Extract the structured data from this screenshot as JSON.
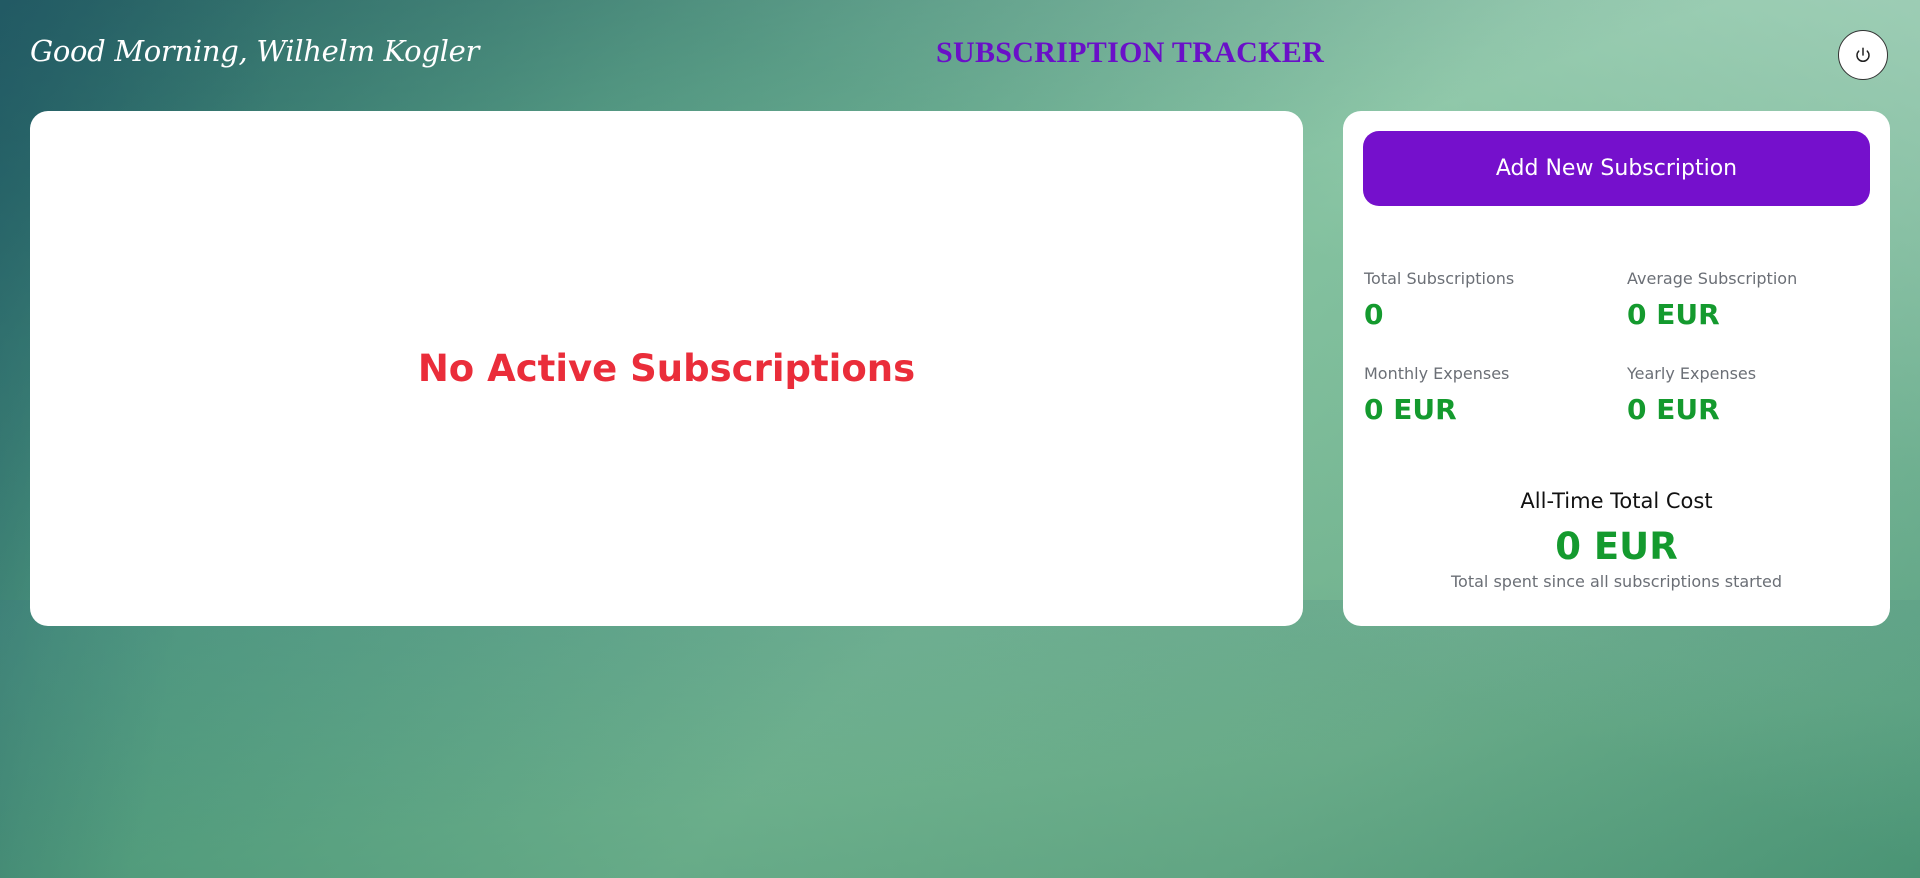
{
  "header": {
    "greeting": "Good Morning, Wilhelm Kogler",
    "app_title": "SUBSCRIPTION TRACKER",
    "power_icon": "power-icon"
  },
  "main": {
    "empty_message": "No Active Subscriptions"
  },
  "sidebar": {
    "add_button_label": "Add New Subscription",
    "stats": {
      "total_subscriptions": {
        "label": "Total Subscriptions",
        "value": "0"
      },
      "average_subscription": {
        "label": "Average Subscription",
        "value": "0 EUR"
      },
      "monthly_expenses": {
        "label": "Monthly Expenses",
        "value": "0 EUR"
      },
      "yearly_expenses": {
        "label": "Yearly Expenses",
        "value": "0 EUR"
      }
    },
    "all_time": {
      "title": "All-Time Total Cost",
      "value": "0 EUR",
      "caption": "Total spent since all subscriptions started"
    }
  },
  "colors": {
    "accent_purple": "#7510cc",
    "title_purple": "#6a10c8",
    "value_green": "#149a2e",
    "empty_red": "#ea2d3a"
  }
}
